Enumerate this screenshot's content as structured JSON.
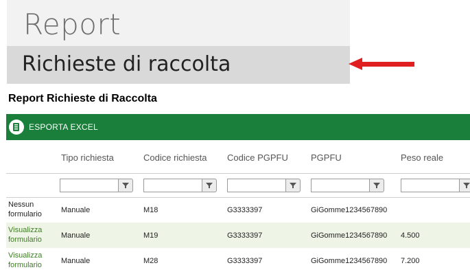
{
  "menu": {
    "header": "Report",
    "item": "Richieste di raccolta"
  },
  "report_title": "Report Richieste di Raccolta",
  "toolbar": {
    "export_label": "ESPORTA EXCEL"
  },
  "columns": [
    "Tipo richiesta",
    "Codice richiesta",
    "Codice PGPFU",
    "PGPFU",
    "Peso reale"
  ],
  "rows": [
    {
      "action": "Nessun formulario",
      "tipo": "Manuale",
      "codice": "M18",
      "pgpfu_code": "G3333397",
      "pgpfu": "GiGomme1234567890",
      "peso": ""
    },
    {
      "action": "Visualizza formulario",
      "tipo": "Manuale",
      "codice": "M19",
      "pgpfu_code": "G3333397",
      "pgpfu": "GiGomme1234567890",
      "peso": "4.500"
    },
    {
      "action": "Visualizza formulario",
      "tipo": "Manuale",
      "codice": "M28",
      "pgpfu_code": "G3333397",
      "pgpfu": "GiGomme1234567890",
      "peso": "7.200"
    }
  ],
  "colors": {
    "toolbar": "#1a7f3a",
    "arrow": "#e02020",
    "link": "#3e7d24",
    "alt_row": "#eef4e6"
  }
}
